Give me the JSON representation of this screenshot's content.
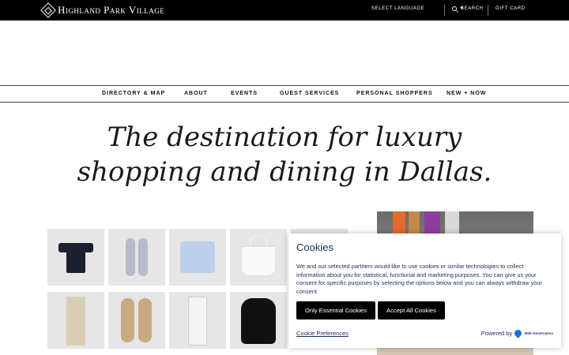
{
  "header": {
    "logo_text": "Highland Park Village",
    "language_label": "SELECT LANGUAGE",
    "language_arrow": "▼",
    "search_label": "SEARCH",
    "gift_card_label": "GIFT CARD"
  },
  "nav": {
    "items": [
      {
        "label": "DIRECTORY & MAP"
      },
      {
        "label": "ABOUT"
      },
      {
        "label": "EVENTS"
      },
      {
        "label": "GUEST SERVICES"
      },
      {
        "label": "PERSONAL SHOPPERS"
      },
      {
        "label": "NEW + NOW"
      }
    ]
  },
  "hero": {
    "line1": "The destination for luxury",
    "line2": "shopping and dining in Dallas."
  },
  "products": {
    "items": [
      {
        "icon": "tshirt-icon"
      },
      {
        "icon": "flats-icon"
      },
      {
        "icon": "shirt-icon"
      },
      {
        "icon": "tote-bag-icon"
      },
      {
        "icon": "chinos-icon"
      },
      {
        "icon": "sneakers-icon"
      },
      {
        "icon": "patterned-pants-icon"
      },
      {
        "icon": "backpack-icon"
      }
    ]
  },
  "cookie_banner": {
    "title": "Cookies",
    "text": "We and our selected partners would like to use cookies or similar technologies to collect information about you for statistical, functional and marketing purposes. You can give us your consent for specific purposes by selecting the options below and you can always withdraw your consent.",
    "essential_button": "Only Essential Cookies",
    "accept_button": "Accept All Cookies",
    "preferences_link": "Cookie Preferences",
    "powered_by": "Powered by",
    "brand": "Web Governance"
  },
  "colors": {
    "topbar": "#000000",
    "cookie_text": "#18305a",
    "button": "#000000"
  }
}
